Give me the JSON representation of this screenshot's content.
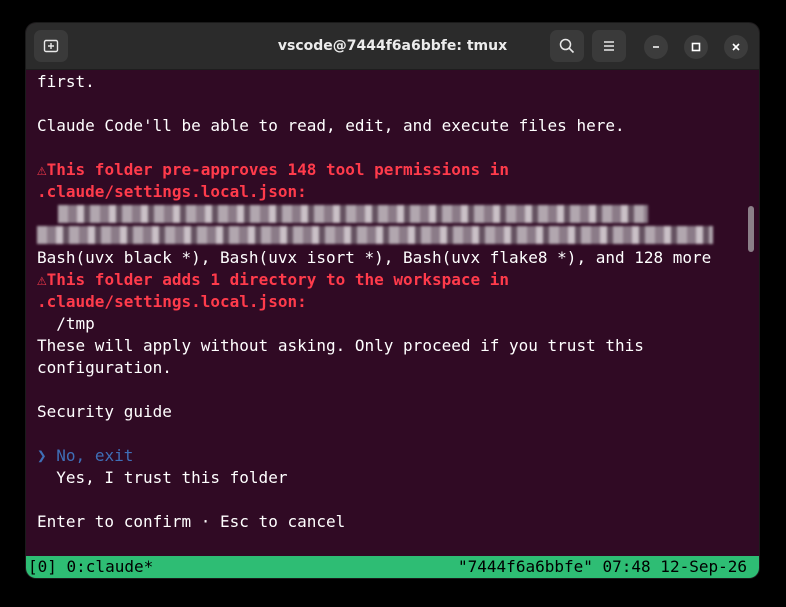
{
  "window": {
    "title": "vscode@7444f6a6bbfe: tmux"
  },
  "terminal": {
    "lines": [
      "first.",
      "Claude Code'll be able to read, edit, and execute files here.",
      "This folder pre-approves 148 tool permissions in",
      ".claude/settings.local.json:",
      "Bash(uvx black *), Bash(uvx isort *), Bash(uvx flake8 *), and 128 more",
      "This folder adds 1 directory to the workspace in",
      ".claude/settings.local.json:",
      "  /tmp",
      "These will apply without asking. Only proceed if you trust this",
      "configuration.",
      "Security guide",
      "No, exit",
      "  Yes, I trust this folder",
      "Enter to confirm · Esc to cancel"
    ],
    "warning_glyph": "⚠",
    "selector_glyph": "❯"
  },
  "statusbar": {
    "session": "[0] 0:claude*",
    "right": "\"7444f6a6bbfe\" 07:48 12-Sep-26"
  },
  "colors": {
    "terminal_bg": "#300a24",
    "warning": "#ff3b4b",
    "selected": "#3f6fb7",
    "statusbar_bg": "#2ebd74"
  },
  "icons": {
    "new_tab": "new-tab-icon",
    "search": "search-icon",
    "menu": "hamburger-menu-icon",
    "minimize": "minimize-icon",
    "maximize": "maximize-icon",
    "close": "close-icon"
  }
}
